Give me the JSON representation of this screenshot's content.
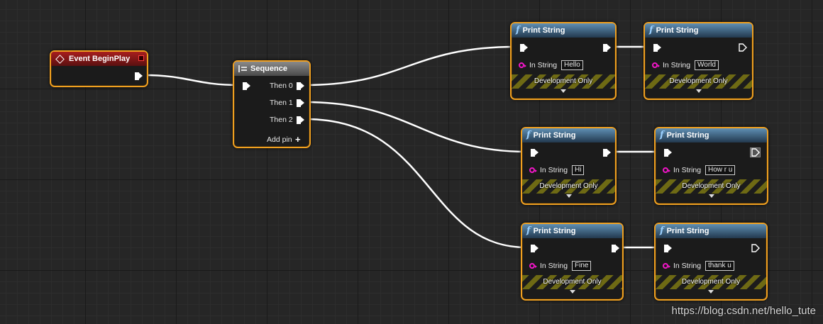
{
  "event_node": {
    "title": "Event BeginPlay"
  },
  "sequence_node": {
    "title": "Sequence",
    "outputs": [
      "Then 0",
      "Then 1",
      "Then 2"
    ],
    "add_pin_label": "Add pin"
  },
  "print_nodes": [
    {
      "title": "Print String",
      "pin_label": "In String",
      "value": "Hello",
      "footer": "Development Only"
    },
    {
      "title": "Print String",
      "pin_label": "In String",
      "value": "World",
      "footer": "Development Only"
    },
    {
      "title": "Print String",
      "pin_label": "In String",
      "value": "Hi",
      "footer": "Development Only"
    },
    {
      "title": "Print String",
      "pin_label": "In String",
      "value": "How r u",
      "footer": "Development Only"
    },
    {
      "title": "Print String",
      "pin_label": "In String",
      "value": "Fine",
      "footer": "Development Only"
    },
    {
      "title": "Print String",
      "pin_label": "In String",
      "value": "thank u",
      "footer": "Development Only"
    }
  ],
  "watermark": "https://blog.csdn.net/hello_tute",
  "colors": {
    "canvas": "#262626",
    "node_border_selected": "#f0a020",
    "event_header": "#a81e1e",
    "function_header": "#3d6384",
    "string_pin": "#f216c8",
    "wire": "#ffffff"
  },
  "icons": {
    "event": "event-diamond-icon",
    "sequence": "sequence-icon",
    "function": "function-icon",
    "exec_pin": "exec-pin-icon",
    "string_pin": "string-pin-icon",
    "add": "plus-icon",
    "expand": "chevron-down-icon"
  }
}
